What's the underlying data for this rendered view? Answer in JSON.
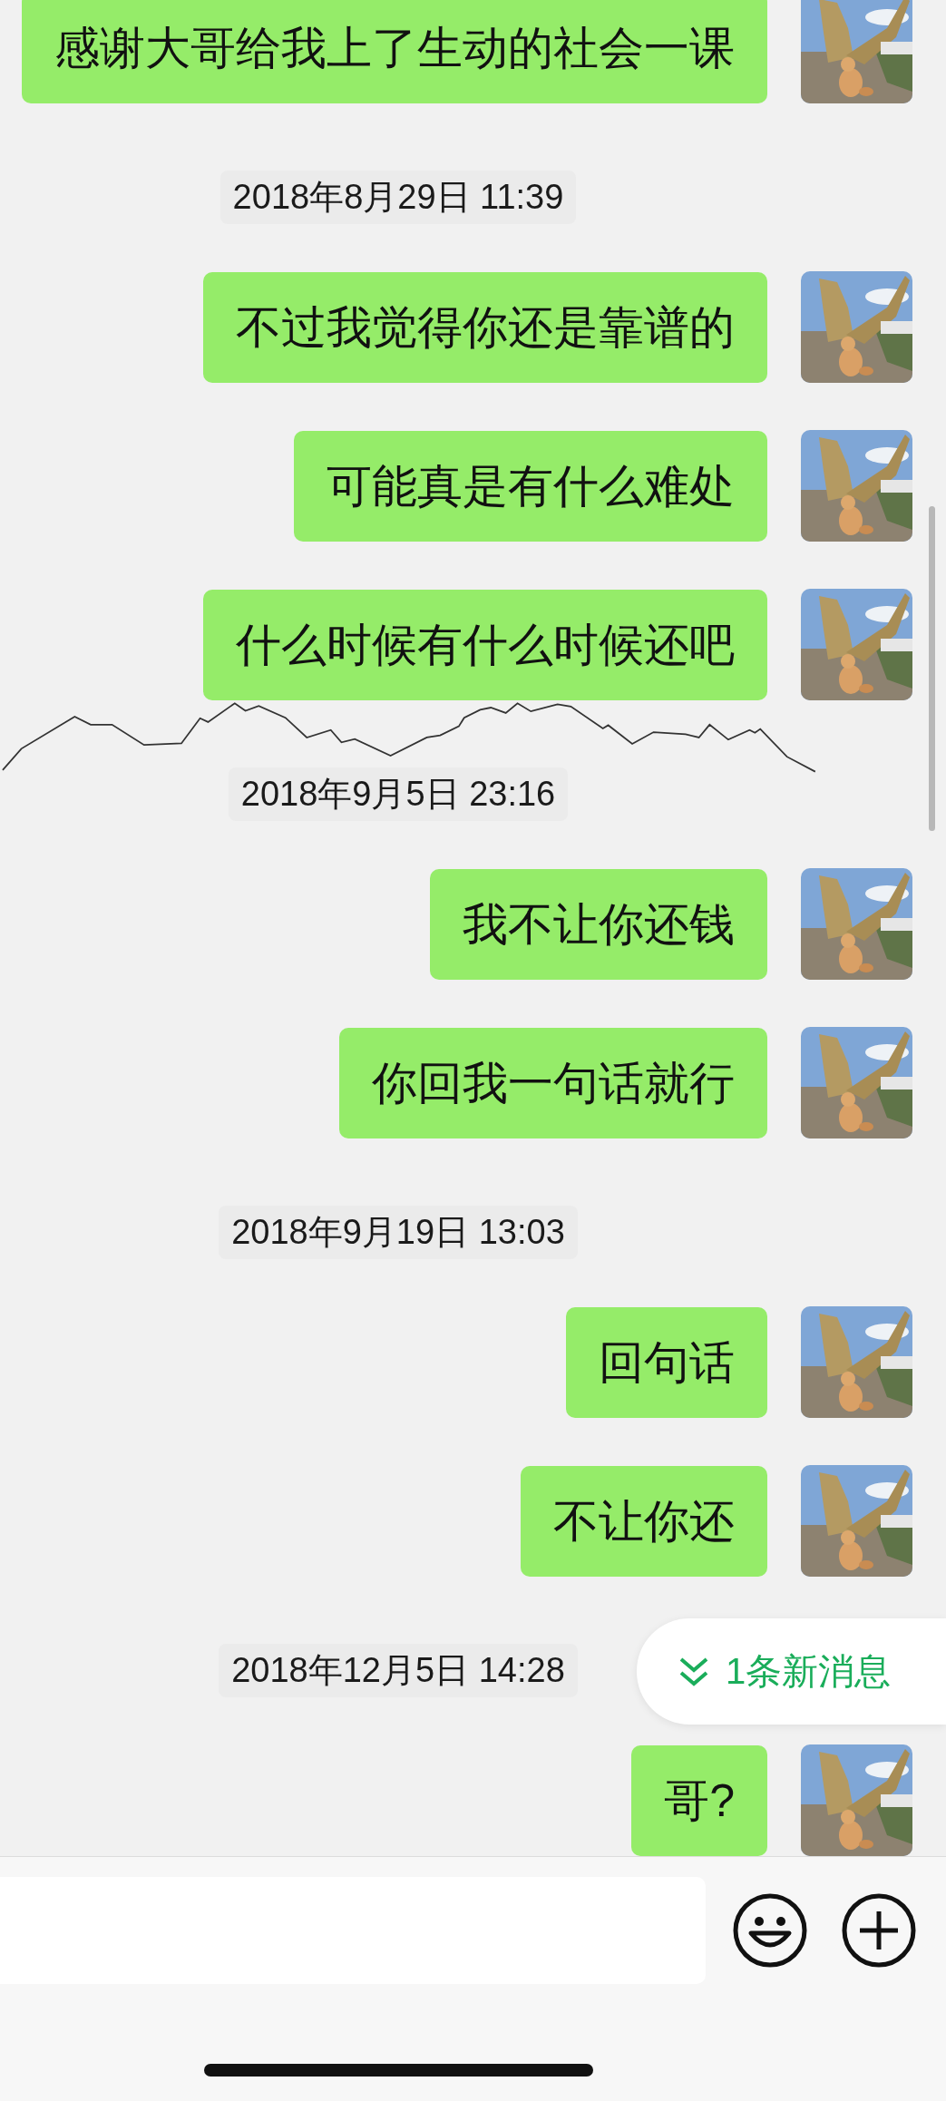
{
  "chat": {
    "items": [
      {
        "kind": "message",
        "text": "感谢大哥给我上了生动的社会一课"
      },
      {
        "kind": "timestamp",
        "text": "2018年8月29日 11:39"
      },
      {
        "kind": "message",
        "text": "不过我觉得你还是靠谱的"
      },
      {
        "kind": "message",
        "text": "可能真是有什么难处"
      },
      {
        "kind": "message",
        "text": "什么时候有什么时候还吧"
      },
      {
        "kind": "timestamp",
        "text": "2018年9月5日 23:16"
      },
      {
        "kind": "message",
        "text": "我不让你还钱"
      },
      {
        "kind": "message",
        "text": "你回我一句话就行"
      },
      {
        "kind": "timestamp",
        "text": "2018年9月19日 13:03"
      },
      {
        "kind": "message",
        "text": "回句话"
      },
      {
        "kind": "message",
        "text": "不让你还"
      },
      {
        "kind": "timestamp",
        "text": "2018年12月5日 14:28"
      },
      {
        "kind": "message",
        "text": "哥?"
      }
    ]
  },
  "new_messages_button": {
    "label": "1条新消息"
  }
}
